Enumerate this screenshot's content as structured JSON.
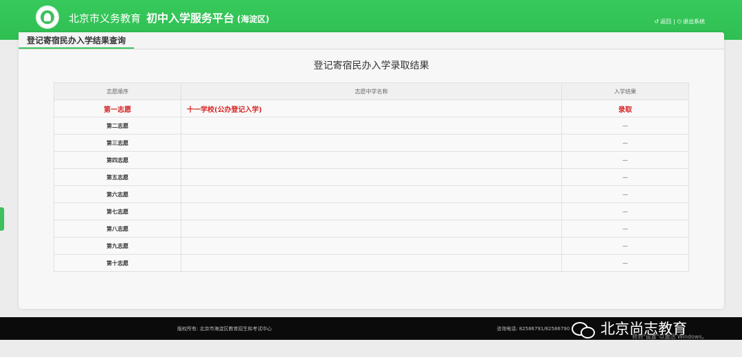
{
  "header": {
    "title_part1": "北京市义务教育",
    "title_part2": "初中入学服务平台",
    "title_district": "(海淀区)",
    "back_label": "返回",
    "logout_label": "退出系统",
    "back_icon": "back-arrow-icon",
    "logout_icon": "power-icon"
  },
  "panel": {
    "tab_label": "登记寄宿民办入学结果查询",
    "result_title": "登记寄宿民办入学录取结果"
  },
  "table": {
    "headers": [
      "志愿顺序",
      "志愿中学名称",
      "入学结果"
    ],
    "rows": [
      {
        "order": "第一志愿",
        "school": "十一学校(公办登记入学)",
        "result": "录取"
      },
      {
        "order": "第二志愿",
        "school": "",
        "result": "—"
      },
      {
        "order": "第三志愿",
        "school": "",
        "result": "—"
      },
      {
        "order": "第四志愿",
        "school": "",
        "result": "—"
      },
      {
        "order": "第五志愿",
        "school": "",
        "result": "—"
      },
      {
        "order": "第六志愿",
        "school": "",
        "result": "—"
      },
      {
        "order": "第七志愿",
        "school": "",
        "result": "—"
      },
      {
        "order": "第八志愿",
        "school": "",
        "result": "—"
      },
      {
        "order": "第九志愿",
        "school": "",
        "result": "—"
      },
      {
        "order": "第十志愿",
        "school": "",
        "result": "—"
      }
    ]
  },
  "footer": {
    "copyright": "版权所有: 北京市海淀区教育招生和考试中心",
    "phone": "咨询电话: 82586791/82586790",
    "brand": "北京尚志教育"
  },
  "watermark": "转到\"设置\"以激活 Windows。",
  "colors": {
    "accent": "#34c759",
    "admitted": "#d62222",
    "footer_bg": "#0b0b0b"
  }
}
